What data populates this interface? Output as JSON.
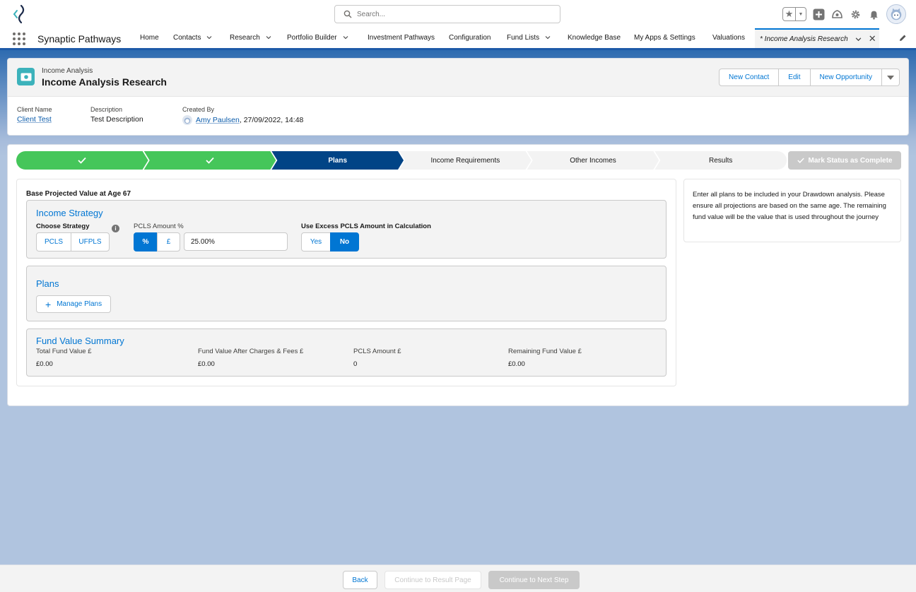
{
  "header": {
    "search_placeholder": "Search...",
    "icons": [
      "favorites-star-icon",
      "add-icon",
      "trailhead-icon",
      "gear-icon",
      "bell-icon",
      "avatar"
    ]
  },
  "nav": {
    "app_name": "Synaptic Pathways",
    "items": [
      {
        "label": "Home"
      },
      {
        "label": "Contacts"
      },
      {
        "label": "Research"
      },
      {
        "label": "Portfolio Builder"
      },
      {
        "label": "Investment Pathways"
      },
      {
        "label": "Configuration"
      },
      {
        "label": "Fund Lists"
      },
      {
        "label": "Knowledge Base"
      },
      {
        "label": "My Apps & Settings"
      },
      {
        "label": "Valuations"
      }
    ],
    "active_tab": "* Income Analysis Research"
  },
  "record": {
    "type": "Income Analysis",
    "name": "Income Analysis Research",
    "actions": {
      "new_contact": "New Contact",
      "edit": "Edit",
      "new_opportunity": "New Opportunity"
    },
    "fields": {
      "client_name_label": "Client Name",
      "client_name": "Client Test",
      "description_label": "Description",
      "description": "Test Description",
      "created_by_label": "Created By",
      "created_by": "Amy Paulsen",
      "created_date": ", 27/09/2022, 14:48"
    }
  },
  "path": {
    "steps": [
      {
        "label": "",
        "status": "complete"
      },
      {
        "label": "",
        "status": "complete"
      },
      {
        "label": "Plans",
        "status": "current"
      },
      {
        "label": "Income Requirements",
        "status": "incomplete"
      },
      {
        "label": "Other Incomes",
        "status": "incomplete"
      },
      {
        "label": "Results",
        "status": "incomplete"
      }
    ],
    "mark_complete": "Mark Status as Complete"
  },
  "form": {
    "age_title": "Base Projected Value at Age 67",
    "income_strategy": {
      "title": "Income Strategy",
      "choose_label": "Choose Strategy",
      "options": [
        "PCLS",
        "UFPLS"
      ],
      "pcls_label": "PCLS Amount %",
      "pcls_units": [
        "%",
        "£"
      ],
      "pcls_selected_unit": "%",
      "pcls_value": "25.00%",
      "excess_label": "Use Excess PCLS Amount in Calculation",
      "excess_options": [
        "Yes",
        "No"
      ],
      "excess_selected": "No"
    },
    "plans": {
      "title": "Plans",
      "manage_label": "Manage Plans"
    },
    "summary": {
      "title": "Fund Value Summary",
      "items": [
        {
          "label": "Total Fund Value £",
          "value": "£0.00"
        },
        {
          "label": "Fund Value After Charges & Fees £",
          "value": "£0.00"
        },
        {
          "label": "PCLS Amount £",
          "value": "0"
        },
        {
          "label": "Remaining Fund Value £",
          "value": "£0.00"
        }
      ]
    }
  },
  "help_text": "Enter all plans to be included in your Drawdown analysis. Please ensure all projections are based on the same age. The remaining fund value will be the value that is used throughout the journey",
  "footer": {
    "back": "Back",
    "continue_result": "Continue to Result Page",
    "continue_next": "Continue to Next Step"
  },
  "colors": {
    "brand": "#0176d3",
    "complete": "#45c65a",
    "current": "#014486",
    "record_icon": "#3cb2bb"
  }
}
